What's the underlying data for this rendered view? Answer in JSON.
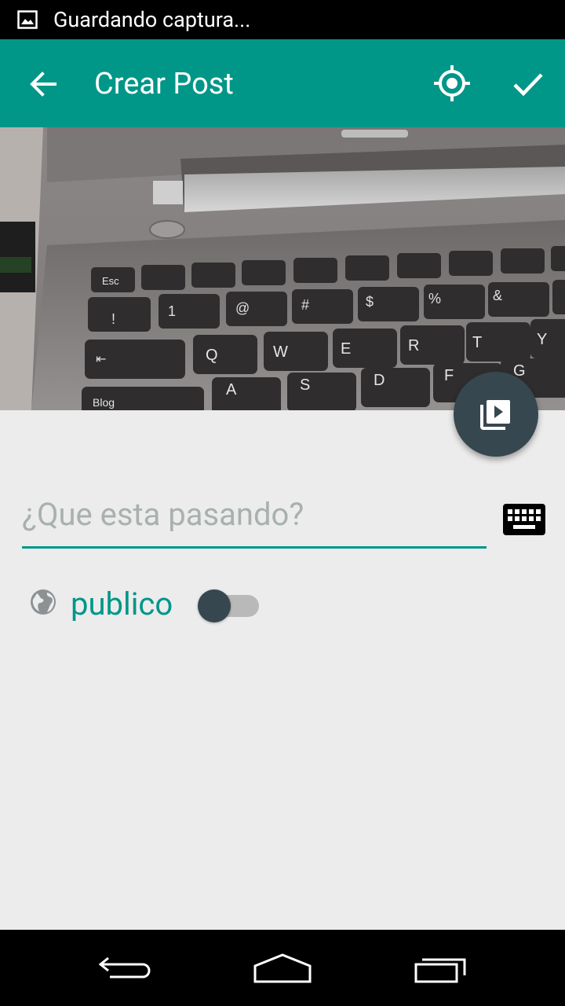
{
  "status_bar": {
    "icon": "image-icon",
    "notification_text": "Guardando captura..."
  },
  "app_bar": {
    "title": "Crear Post",
    "back_icon": "arrow-back-icon",
    "location_icon": "gps-fixed-icon",
    "confirm_icon": "check-icon",
    "background_color": "#009688"
  },
  "photo": {
    "description_icon": "photo-preview",
    "key_labels": [
      "Esc",
      "Q",
      "W",
      "E",
      "R",
      "T",
      "Y",
      "A",
      "S",
      "D",
      "F",
      "G",
      "Blog"
    ]
  },
  "media_fab": {
    "icon": "video-library-icon",
    "color": "#37474f"
  },
  "post_input": {
    "placeholder": "¿Que esta pasando?",
    "value": ""
  },
  "keyboard_toggle": {
    "icon": "keyboard-icon"
  },
  "visibility": {
    "icon": "globe-icon",
    "label": "publico",
    "switch_on": false
  },
  "nav_bar": {
    "back_icon": "nav-back-icon",
    "home_icon": "nav-home-icon",
    "recents_icon": "nav-recents-icon"
  },
  "colors": {
    "accent": "#009688",
    "dark": "#37474f",
    "background": "#ececec"
  }
}
